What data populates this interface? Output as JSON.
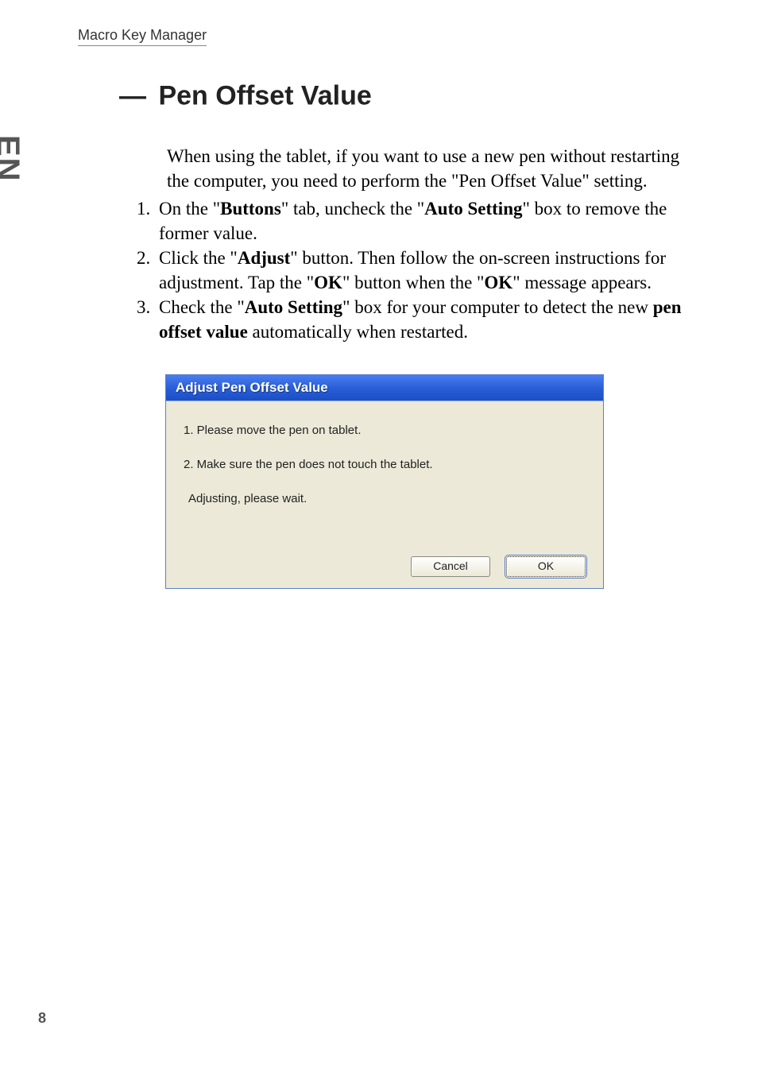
{
  "header": "Macro Key Manager",
  "side_lang": "EN",
  "page_number": "8",
  "section": {
    "dash": "—",
    "title": "Pen Offset Value",
    "intro": "When using the tablet, if you want to use a new pen without restarting the computer, you need to perform the \"Pen Offset Value\" setting.",
    "steps": [
      {
        "num": "1.",
        "pre": "On the \"",
        "b1": "Buttons",
        "mid1": "\" tab, uncheck the \"",
        "b2": "Auto Setting",
        "post": "\" box to remove the former value."
      },
      {
        "num": "2.",
        "pre": "Click the \"",
        "b1": "Adjust",
        "mid1": "\" button. Then follow the on-screen instructions for adjustment. Tap the \"",
        "b2": "OK",
        "mid2": "\" button when the \"",
        "b3": "OK",
        "post": "\" message appears."
      },
      {
        "num": "3.",
        "pre": "Check the \"",
        "b1": "Auto Setting",
        "mid1": "\" box for your computer to detect the new ",
        "b2": "pen offset value",
        "post": " automatically when restarted."
      }
    ]
  },
  "dialog": {
    "title": "Adjust Pen Offset Value",
    "line1": "1. Please move the pen on tablet.",
    "line2": "2. Make sure the pen does not touch the tablet.",
    "status": "Adjusting, please wait.",
    "cancel": "Cancel",
    "ok": "OK"
  }
}
